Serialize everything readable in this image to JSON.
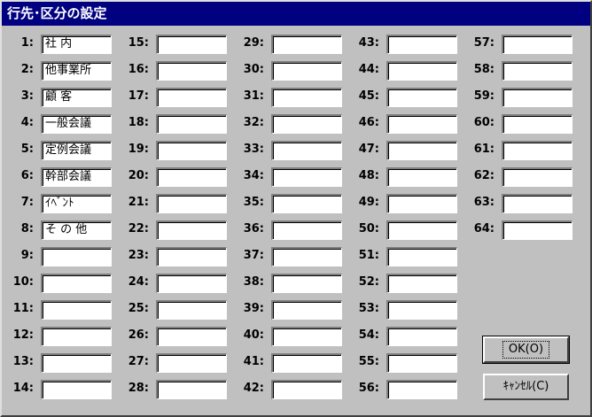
{
  "window": {
    "title": "行先･区分の設定"
  },
  "columns": [
    {
      "items": [
        {
          "label": "1:",
          "value": "社 内"
        },
        {
          "label": "2:",
          "value": "他事業所"
        },
        {
          "label": "3:",
          "value": "顧 客"
        },
        {
          "label": "4:",
          "value": "一般会議"
        },
        {
          "label": "5:",
          "value": "定例会議"
        },
        {
          "label": "6:",
          "value": "幹部会議"
        },
        {
          "label": "7:",
          "value": "ｲﾍﾞﾝﾄ"
        },
        {
          "label": "8:",
          "value": "そ の 他"
        },
        {
          "label": "9:",
          "value": ""
        },
        {
          "label": "10:",
          "value": ""
        },
        {
          "label": "11:",
          "value": ""
        },
        {
          "label": "12:",
          "value": ""
        },
        {
          "label": "13:",
          "value": ""
        },
        {
          "label": "14:",
          "value": ""
        }
      ]
    },
    {
      "items": [
        {
          "label": "15:",
          "value": ""
        },
        {
          "label": "16:",
          "value": ""
        },
        {
          "label": "17:",
          "value": ""
        },
        {
          "label": "18:",
          "value": ""
        },
        {
          "label": "19:",
          "value": ""
        },
        {
          "label": "20:",
          "value": ""
        },
        {
          "label": "21:",
          "value": ""
        },
        {
          "label": "22:",
          "value": ""
        },
        {
          "label": "23:",
          "value": ""
        },
        {
          "label": "24:",
          "value": ""
        },
        {
          "label": "25:",
          "value": ""
        },
        {
          "label": "26:",
          "value": ""
        },
        {
          "label": "27:",
          "value": ""
        },
        {
          "label": "28:",
          "value": ""
        }
      ]
    },
    {
      "items": [
        {
          "label": "29:",
          "value": ""
        },
        {
          "label": "30:",
          "value": ""
        },
        {
          "label": "31:",
          "value": ""
        },
        {
          "label": "32:",
          "value": ""
        },
        {
          "label": "33:",
          "value": ""
        },
        {
          "label": "34:",
          "value": ""
        },
        {
          "label": "35:",
          "value": ""
        },
        {
          "label": "36:",
          "value": ""
        },
        {
          "label": "37:",
          "value": ""
        },
        {
          "label": "38:",
          "value": ""
        },
        {
          "label": "39:",
          "value": ""
        },
        {
          "label": "40:",
          "value": ""
        },
        {
          "label": "41:",
          "value": ""
        },
        {
          "label": "42:",
          "value": ""
        }
      ]
    },
    {
      "items": [
        {
          "label": "43:",
          "value": ""
        },
        {
          "label": "44:",
          "value": ""
        },
        {
          "label": "45:",
          "value": ""
        },
        {
          "label": "46:",
          "value": ""
        },
        {
          "label": "47:",
          "value": ""
        },
        {
          "label": "48:",
          "value": ""
        },
        {
          "label": "49:",
          "value": ""
        },
        {
          "label": "50:",
          "value": ""
        },
        {
          "label": "51:",
          "value": ""
        },
        {
          "label": "52:",
          "value": ""
        },
        {
          "label": "53:",
          "value": ""
        },
        {
          "label": "54:",
          "value": ""
        },
        {
          "label": "55:",
          "value": ""
        },
        {
          "label": "56:",
          "value": ""
        }
      ]
    },
    {
      "items": [
        {
          "label": "57:",
          "value": ""
        },
        {
          "label": "58:",
          "value": ""
        },
        {
          "label": "59:",
          "value": ""
        },
        {
          "label": "60:",
          "value": ""
        },
        {
          "label": "61:",
          "value": ""
        },
        {
          "label": "62:",
          "value": ""
        },
        {
          "label": "63:",
          "value": ""
        },
        {
          "label": "64:",
          "value": ""
        }
      ]
    }
  ],
  "buttons": {
    "ok_label": "OK(O)",
    "cancel_label": "ｷｬﾝｾﾙ(C)"
  },
  "colors": {
    "titlebar": "#000080",
    "face": "#c0c0c0"
  }
}
